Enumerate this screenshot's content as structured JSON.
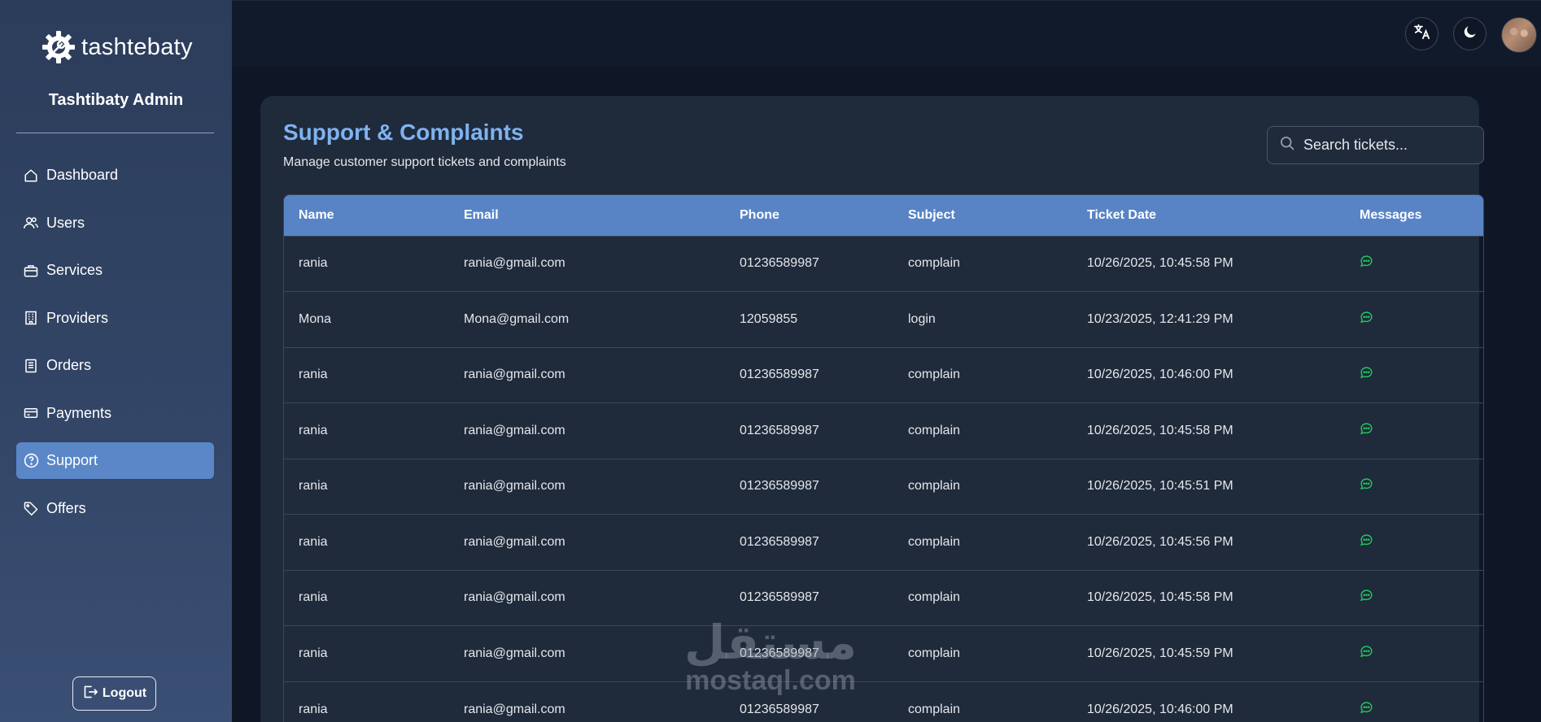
{
  "brand": {
    "name": "tashtebaty"
  },
  "sidebar": {
    "title": "Tashtibaty Admin",
    "items": [
      {
        "label": "Dashboard",
        "icon": "home-icon",
        "active": false
      },
      {
        "label": "Users",
        "icon": "users-icon",
        "active": false
      },
      {
        "label": "Services",
        "icon": "briefcase-icon",
        "active": false
      },
      {
        "label": "Providers",
        "icon": "building-icon",
        "active": false
      },
      {
        "label": "Orders",
        "icon": "receipt-icon",
        "active": false
      },
      {
        "label": "Payments",
        "icon": "credit-card-icon",
        "active": false
      },
      {
        "label": "Support",
        "icon": "help-circle-icon",
        "active": true
      },
      {
        "label": "Offers",
        "icon": "tag-icon",
        "active": false
      }
    ],
    "logout_label": "Logout"
  },
  "topbar": {
    "icons": [
      "translate-icon",
      "moon-icon",
      "user-avatar"
    ]
  },
  "page": {
    "title": "Support & Complaints",
    "subtitle": "Manage customer support tickets and complaints"
  },
  "search": {
    "placeholder": "Search tickets..."
  },
  "table": {
    "columns": [
      "Name",
      "Email",
      "Phone",
      "Subject",
      "Ticket Date",
      "Messages"
    ],
    "rows": [
      {
        "name": "rania",
        "email": "rania@gmail.com",
        "phone": "01236589987",
        "subject": "complain",
        "date": "10/26/2025, 10:45:58 PM"
      },
      {
        "name": "Mona",
        "email": "Mona@gmail.com",
        "phone": "12059855",
        "subject": "login",
        "date": "10/23/2025, 12:41:29 PM"
      },
      {
        "name": "rania",
        "email": "rania@gmail.com",
        "phone": "01236589987",
        "subject": "complain",
        "date": "10/26/2025, 10:46:00 PM"
      },
      {
        "name": "rania",
        "email": "rania@gmail.com",
        "phone": "01236589987",
        "subject": "complain",
        "date": "10/26/2025, 10:45:58 PM"
      },
      {
        "name": "rania",
        "email": "rania@gmail.com",
        "phone": "01236589987",
        "subject": "complain",
        "date": "10/26/2025, 10:45:51 PM"
      },
      {
        "name": "rania",
        "email": "rania@gmail.com",
        "phone": "01236589987",
        "subject": "complain",
        "date": "10/26/2025, 10:45:56 PM"
      },
      {
        "name": "rania",
        "email": "rania@gmail.com",
        "phone": "01236589987",
        "subject": "complain",
        "date": "10/26/2025, 10:45:58 PM"
      },
      {
        "name": "rania",
        "email": "rania@gmail.com",
        "phone": "01236589987",
        "subject": "complain",
        "date": "10/26/2025, 10:45:59 PM"
      },
      {
        "name": "rania",
        "email": "rania@gmail.com",
        "phone": "01236589987",
        "subject": "complain",
        "date": "10/26/2025, 10:46:00 PM"
      }
    ]
  },
  "watermark": {
    "arabic": "مستقل",
    "latin": "mostaql.com"
  },
  "colors": {
    "sidebar_bg": "#324566",
    "active_item": "#5b87c8",
    "table_header": "#5884c6",
    "title_accent": "#7fb2f0",
    "message_icon": "#22c55e",
    "page_bg": "#0f1726"
  }
}
